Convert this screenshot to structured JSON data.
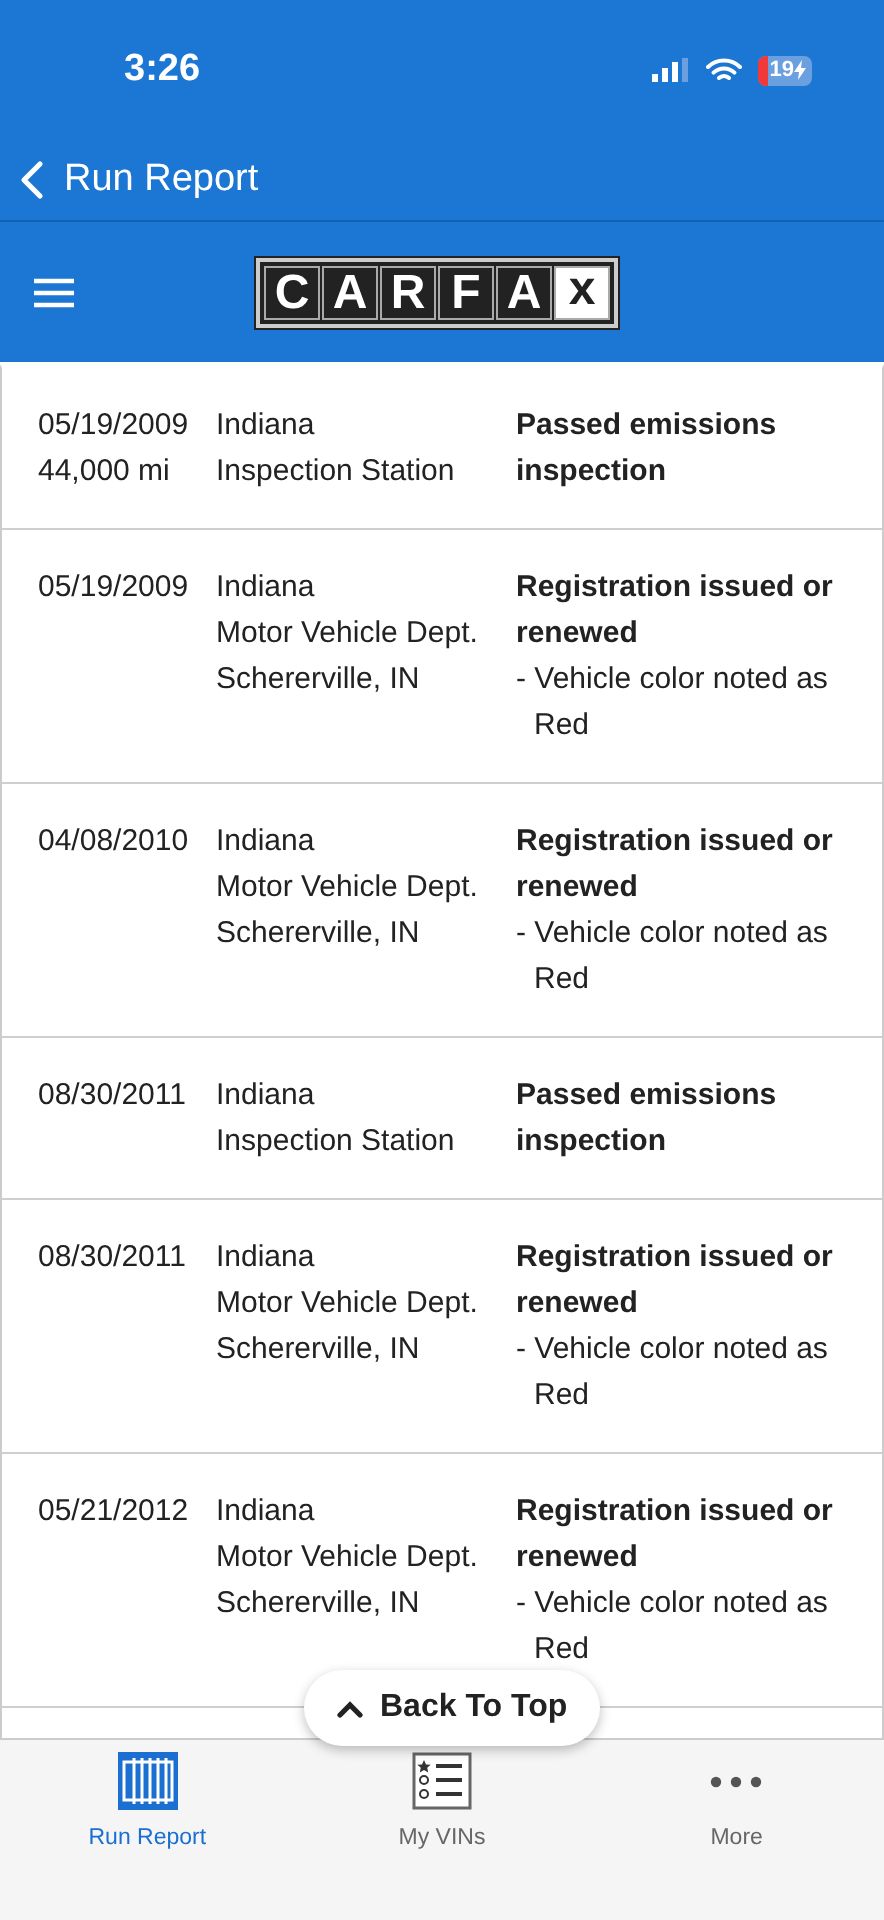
{
  "status_bar": {
    "time": "3:26",
    "battery": "19"
  },
  "nav": {
    "back_label": "Run Report"
  },
  "logo": {
    "letters": [
      "C",
      "A",
      "R",
      "F",
      "A",
      "x"
    ]
  },
  "records": [
    {
      "date": "05/19/2009",
      "odometer": "44,000 mi",
      "source": [
        "Indiana",
        "Inspection Station"
      ],
      "event": "Passed emissions inspection"
    },
    {
      "date": "05/19/2009",
      "source": [
        "Indiana",
        "Motor Vehicle Dept.",
        "Schererville, IN"
      ],
      "event": "Registration issued or renewed",
      "comment": "- Vehicle color noted as Red"
    },
    {
      "date": "04/08/2010",
      "source": [
        "Indiana",
        "Motor Vehicle Dept.",
        "Schererville, IN"
      ],
      "event": "Registration issued or renewed",
      "comment": "- Vehicle color noted as Red"
    },
    {
      "date": "08/30/2011",
      "source": [
        "Indiana",
        "Inspection Station"
      ],
      "event": "Passed emissions inspection"
    },
    {
      "date": "08/30/2011",
      "source": [
        "Indiana",
        "Motor Vehicle Dept.",
        "Schererville, IN"
      ],
      "event": "Registration issued or renewed",
      "comment": "- Vehicle color noted as Red"
    },
    {
      "date": "05/21/2012",
      "source": [
        "Indiana",
        "Motor Vehicle Dept.",
        "Schererville, IN"
      ],
      "event": "Registration issued or renewed",
      "comment": "- Vehicle color noted as Red"
    }
  ],
  "back_to_top": "Back To Top",
  "tabs": [
    {
      "label": "Run Report",
      "kind": "report",
      "selected": true
    },
    {
      "label": "My VINs",
      "kind": "list",
      "selected": false
    },
    {
      "label": "More",
      "kind": "more",
      "selected": false
    }
  ]
}
